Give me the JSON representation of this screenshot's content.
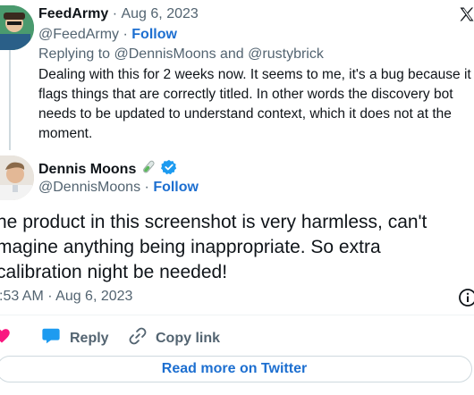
{
  "reply_tweet": {
    "display_name": "FeedArmy",
    "date": "Aug 6, 2023",
    "separator": "·",
    "handle": "@FeedArmy",
    "follow_label": "Follow",
    "replying_to": "Replying to @DennisMoons and @rustybrick",
    "text": "Dealing with this for 2 weeks now. It seems to me, it's a bug because it flags things that are correctly titled. In other words the discovery bot needs to be updated to understand context, which it does not at the moment."
  },
  "main_tweet": {
    "display_name": "Dennis Moons",
    "handle": "@DennisMoons",
    "follow_label": "Follow",
    "text": "he product in this screenshot is very harmless, can't magine anything being inappropriate. So extra calibration night be needed!",
    "timestamp": ":53 AM · Aug 6, 2023"
  },
  "actions": {
    "reply_label": "Reply",
    "copy_link_label": "Copy link"
  },
  "read_more_label": "Read more on Twitter",
  "icons": {
    "brand": "x-logo-icon",
    "verified": "verified-badge-icon",
    "emoji": "test-tube-icon",
    "info": "info-icon",
    "like": "heart-icon",
    "reply": "speech-bubble-icon",
    "copy": "link-icon"
  },
  "colors": {
    "accent": "#1d6fd0",
    "verified": "#1d9bf0",
    "like": "#f91880",
    "muted": "#536471"
  }
}
